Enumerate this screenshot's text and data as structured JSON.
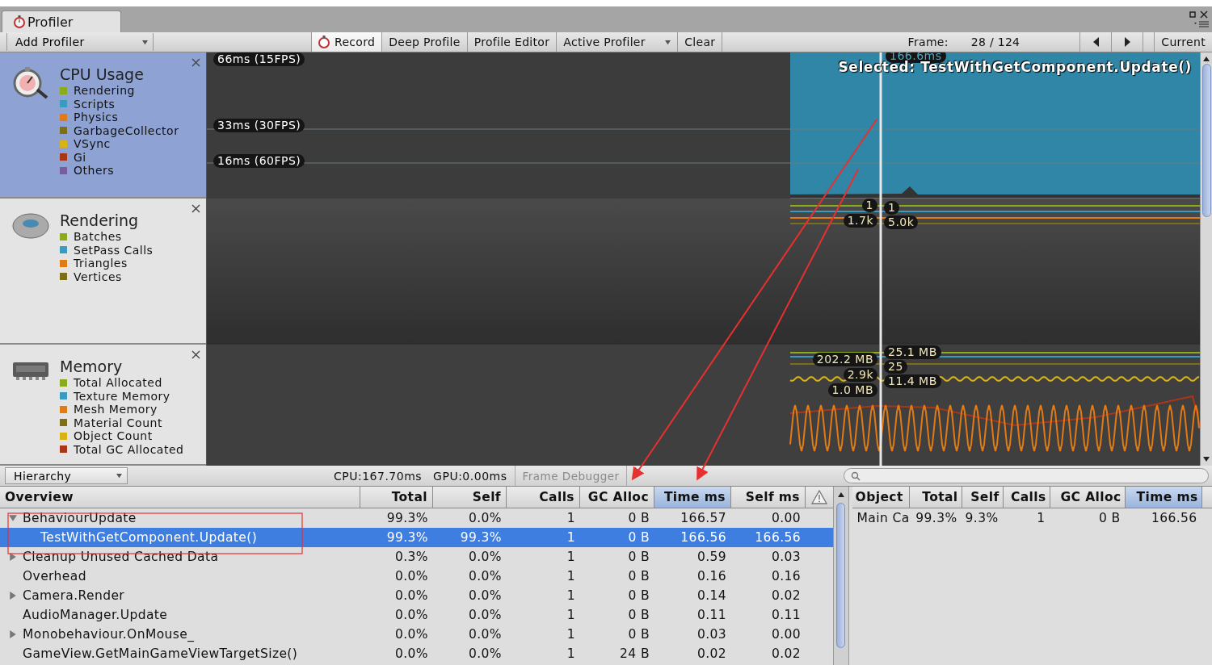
{
  "window": {
    "tab": "Profiler"
  },
  "toolbar": {
    "add_profiler": "Add Profiler",
    "buttons": [
      {
        "label": "Record",
        "kind": "record",
        "selected": true
      },
      {
        "label": "Deep Profile",
        "kind": "toggle",
        "selected": false
      },
      {
        "label": "Profile Editor",
        "kind": "toggle",
        "selected": false
      },
      {
        "label": "Active Profiler",
        "kind": "dropdown",
        "selected": false
      },
      {
        "label": "Clear",
        "kind": "toggle",
        "selected": false
      }
    ],
    "frame_label": "Frame:",
    "frame_value": "28 / 124",
    "current": "Current"
  },
  "modules": [
    {
      "kind": "cpu",
      "title": "CPU Usage",
      "selected": true,
      "legend": [
        {
          "label": "Rendering",
          "color": "#8aab1c"
        },
        {
          "label": "Scripts",
          "color": "#3a9bc0"
        },
        {
          "label": "Physics",
          "color": "#e07b16"
        },
        {
          "label": "GarbageCollector",
          "color": "#7d6e1a"
        },
        {
          "label": "VSync",
          "color": "#d8b316"
        },
        {
          "label": "Gi",
          "color": "#a8371a"
        },
        {
          "label": "Others",
          "color": "#7a5ca0"
        }
      ],
      "graph": {
        "guides": [
          "66ms (15FPS)",
          "33ms (30FPS)",
          "16ms (60FPS)"
        ],
        "selected_time": "166.6ms",
        "selected_name": "Selected: TestWithGetComponent.Update()"
      }
    },
    {
      "kind": "rendering",
      "title": "Rendering",
      "selected": false,
      "legend": [
        {
          "label": "Batches",
          "color": "#8aab1c"
        },
        {
          "label": "SetPass Calls",
          "color": "#3a9bc0"
        },
        {
          "label": "Triangles",
          "color": "#e07b16"
        },
        {
          "label": "Vertices",
          "color": "#7d6e1a"
        }
      ],
      "graph": {
        "left_values": [
          "1",
          "1.7k"
        ],
        "right_values": [
          "1",
          "5.0k"
        ]
      }
    },
    {
      "kind": "memory",
      "title": "Memory",
      "selected": false,
      "legend": [
        {
          "label": "Total Allocated",
          "color": "#8aab1c"
        },
        {
          "label": "Texture Memory",
          "color": "#3a9bc0"
        },
        {
          "label": "Mesh Memory",
          "color": "#e07b16"
        },
        {
          "label": "Material Count",
          "color": "#7d6e1a"
        },
        {
          "label": "Object Count",
          "color": "#d8b316"
        },
        {
          "label": "Total GC Allocated",
          "color": "#a8371a"
        }
      ],
      "graph": {
        "left_values": [
          "202.2 MB",
          "2.9k",
          "1.0 MB"
        ],
        "right_values": [
          "25.1 MB",
          "25",
          "11.4 MB"
        ]
      }
    }
  ],
  "bottom_bar": {
    "view": "Hierarchy",
    "cpu": "CPU:167.70ms",
    "gpu": "GPU:0.00ms",
    "frame_debugger": {
      "label": "Frame Debugger",
      "disabled": true
    }
  },
  "hierarchy": {
    "columns": [
      {
        "label": "Overview",
        "selected": false
      },
      {
        "label": "Total",
        "selected": false
      },
      {
        "label": "Self",
        "selected": false
      },
      {
        "label": "Calls",
        "selected": false
      },
      {
        "label": "GC Alloc",
        "selected": false
      },
      {
        "label": "Time ms",
        "selected": true
      },
      {
        "label": "Self ms",
        "selected": false
      }
    ],
    "rows": [
      {
        "name": "BehaviourUpdate",
        "kind": "group",
        "expanded": true,
        "selected": false,
        "values": [
          "99.3%",
          "0.0%",
          "1",
          "0 B",
          "166.57",
          "0.00"
        ],
        "children": [
          {
            "name": "TestWithGetComponent.Update()",
            "kind": "item",
            "selected": true,
            "values": [
              "99.3%",
              "99.3%",
              "1",
              "0 B",
              "166.56",
              "166.56"
            ]
          }
        ]
      },
      {
        "name": "Cleanup Unused Cached Data",
        "kind": "group",
        "expanded": false,
        "selected": false,
        "values": [
          "0.3%",
          "0.0%",
          "1",
          "0 B",
          "0.59",
          "0.03"
        ]
      },
      {
        "name": "Overhead",
        "kind": "item",
        "selected": false,
        "values": [
          "0.0%",
          "0.0%",
          "1",
          "0 B",
          "0.16",
          "0.16"
        ]
      },
      {
        "name": "Camera.Render",
        "kind": "group",
        "expanded": false,
        "selected": false,
        "values": [
          "0.0%",
          "0.0%",
          "1",
          "0 B",
          "0.14",
          "0.02"
        ]
      },
      {
        "name": "AudioManager.Update",
        "kind": "item",
        "selected": false,
        "values": [
          "0.0%",
          "0.0%",
          "1",
          "0 B",
          "0.11",
          "0.11"
        ]
      },
      {
        "name": "Monobehaviour.OnMouse_",
        "kind": "group",
        "expanded": false,
        "selected": false,
        "values": [
          "0.0%",
          "0.0%",
          "1",
          "0 B",
          "0.03",
          "0.00"
        ]
      },
      {
        "name": "GameView.GetMainGameViewTargetSize()",
        "kind": "item",
        "selected": false,
        "values": [
          "0.0%",
          "0.0%",
          "1",
          "24 B",
          "0.02",
          "0.02"
        ]
      }
    ]
  },
  "details": {
    "columns": [
      {
        "label": "Object",
        "selected": false
      },
      {
        "label": "Total",
        "selected": false
      },
      {
        "label": "Self",
        "selected": false
      },
      {
        "label": "Calls",
        "selected": false
      },
      {
        "label": "GC Alloc",
        "selected": false
      },
      {
        "label": "Time ms",
        "selected": true
      }
    ],
    "rows": [
      {
        "cells": [
          "Main Ca",
          "99.3%",
          "9.3%",
          "1",
          "0 B",
          "166.56"
        ]
      }
    ]
  }
}
